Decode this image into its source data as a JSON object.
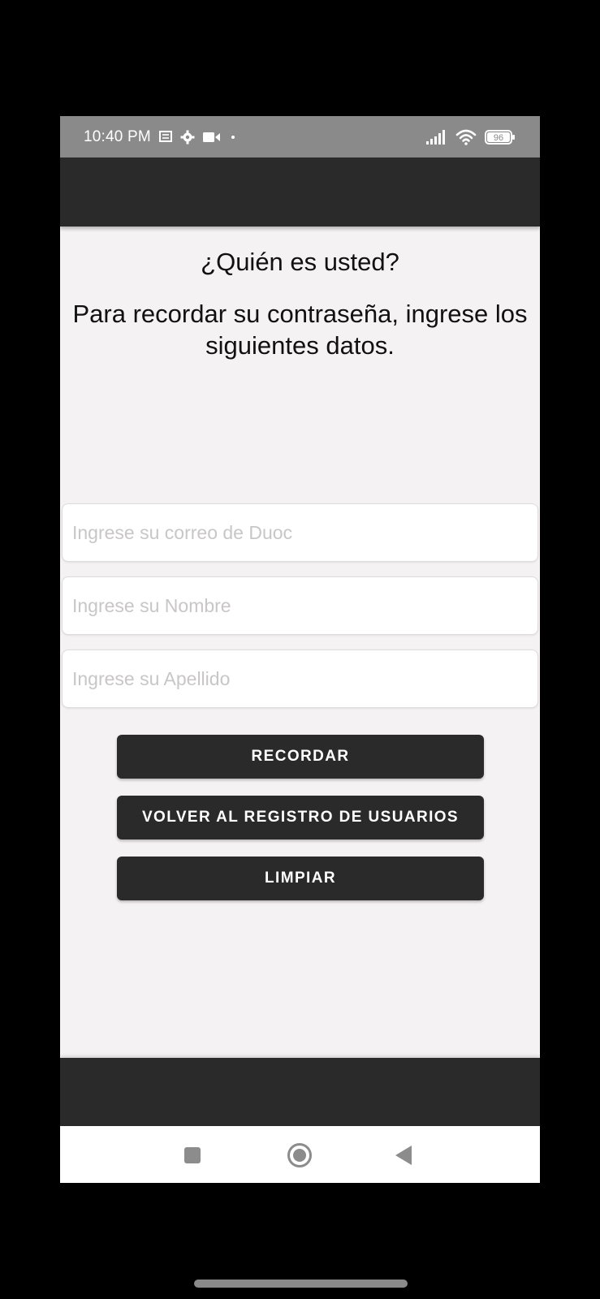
{
  "status_bar": {
    "time": "10:40 PM",
    "battery": "96",
    "icons": [
      "message-icon",
      "gear-icon",
      "video-camera-icon",
      "dot-icon",
      "signal-icon",
      "wifi-icon",
      "battery-icon"
    ]
  },
  "screen": {
    "title": "¿Quién es usted?",
    "subtitle": "Para recordar su contraseña, ingrese los siguientes datos."
  },
  "form": {
    "email": {
      "value": "",
      "placeholder": "Ingrese su correo de Duoc"
    },
    "name": {
      "value": "",
      "placeholder": "Ingrese su Nombre"
    },
    "lastname": {
      "value": "",
      "placeholder": "Ingrese su Apellido"
    }
  },
  "buttons": {
    "remember": "RECORDAR",
    "back": "VOLVER AL REGISTRO DE USUARIOS",
    "clear": "LIMPIAR"
  },
  "nav": {
    "icons": [
      "recents-square-icon",
      "home-circle-icon",
      "back-triangle-icon"
    ]
  },
  "colors": {
    "background": "#000000",
    "screen_bg": "#f5f2f3",
    "status_bar": "#8a8a8a",
    "app_bar": "#2b2a2b",
    "button": "#2b2a2b",
    "placeholder": "#c8c6c7"
  }
}
